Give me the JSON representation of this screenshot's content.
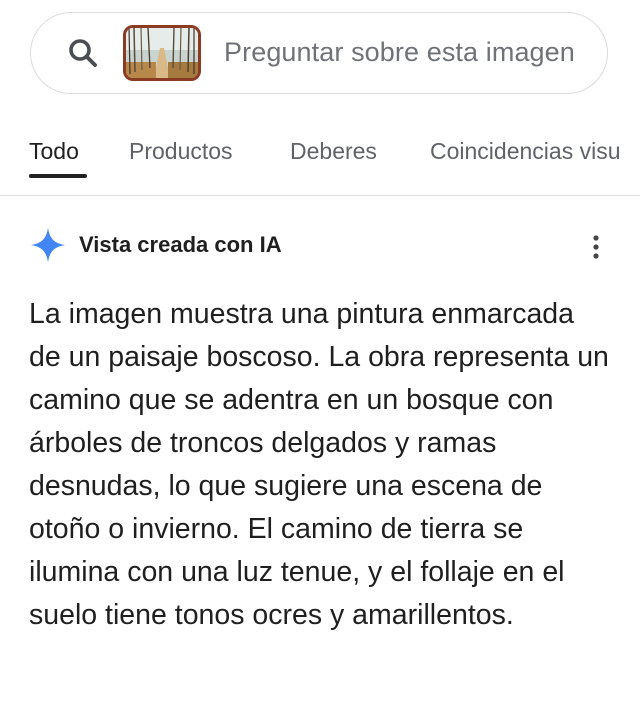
{
  "search": {
    "placeholder": "Preguntar sobre esta imagen",
    "search_icon": "search-icon",
    "thumbnail": "painting-thumbnail"
  },
  "tabs": [
    {
      "label": "Todo",
      "active": true
    },
    {
      "label": "Productos",
      "active": false
    },
    {
      "label": "Deberes",
      "active": false
    },
    {
      "label": "Coincidencias visu",
      "active": false
    }
  ],
  "ai_overview": {
    "title": "Vista creada con IA",
    "icon": "sparkle-icon",
    "menu_icon": "more-vert-icon",
    "body": "La imagen muestra una pintura enmarcada de un paisaje boscoso. La obra representa un camino que se adentra en un bosque con árboles de troncos delgados y ramas desnudas, lo que sugiere una escena de otoño o invierno. El camino de tierra se ilumina con una luz tenue, y el follaje en el suelo tiene tonos ocres y amarillentos."
  },
  "colors": {
    "accent_blue": "#4285f4",
    "text_primary": "#1f1f1f",
    "text_secondary": "#5f6368",
    "border": "#dadce0"
  }
}
